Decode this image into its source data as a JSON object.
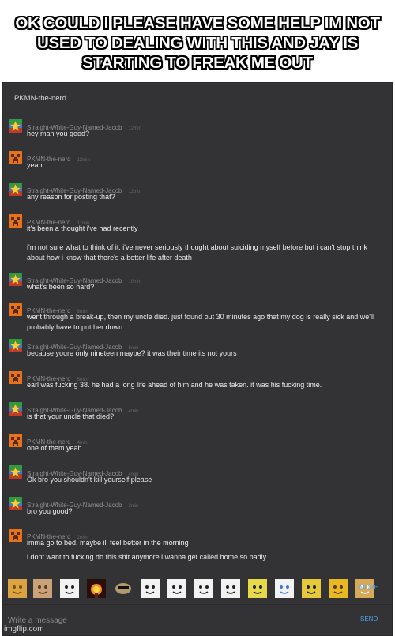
{
  "caption": "OK COULD I PLEASE HAVE SOME HELP IM NOT USED TO DEALING WITH THIS AND JAY IS STARTING TO FREAK ME OUT",
  "chat": {
    "header_title": "PKMN-the-nerd",
    "messages": [
      {
        "author": "Straight-White-Guy-Named-Jacob",
        "time": "12min",
        "avatar": "star-avatar-icon",
        "text": "hey man you good?"
      },
      {
        "author": "PKMN-the-nerd",
        "time": "12min",
        "avatar": "creeper-avatar-icon",
        "text": "yeah"
      },
      {
        "author": "Straight-White-Guy-Named-Jacob",
        "time": "12min",
        "avatar": "star-avatar-icon",
        "text": "any reason for posting that?"
      },
      {
        "author": "PKMN-the-nerd",
        "time": "11min",
        "avatar": "creeper-avatar-icon",
        "text": "it's been a thought i've had recently",
        "extra": "i'm not sure what to think of it. i've never seriously thought about suiciding myself before but i can't stop think about how i know that there's a better life after death"
      },
      {
        "author": "Straight-White-Guy-Named-Jacob",
        "time": "10min",
        "avatar": "star-avatar-icon",
        "text": "what's been so hard?"
      },
      {
        "author": "PKMN-the-nerd",
        "time": "8min",
        "avatar": "creeper-avatar-icon",
        "text": "went through a break-up, then my uncle died. just found out 30 minutes ago that my dog is really sick and we'll probably have to put her down"
      },
      {
        "author": "Straight-White-Guy-Named-Jacob",
        "time": "6min",
        "avatar": "star-avatar-icon",
        "text": "because youre only nineteen maybe? it was their time its not yours"
      },
      {
        "author": "PKMN-the-nerd",
        "time": "5min",
        "avatar": "creeper-avatar-icon",
        "text": "earl was fucking 38. he had a long life ahead of him and he was taken. it was his fucking time."
      },
      {
        "author": "Straight-White-Guy-Named-Jacob",
        "time": "4min",
        "avatar": "star-avatar-icon",
        "text": "is that your uncle that died?"
      },
      {
        "author": "PKMN-the-nerd",
        "time": "4min",
        "avatar": "creeper-avatar-icon",
        "text": "one of them yeah"
      },
      {
        "author": "Straight-White-Guy-Named-Jacob",
        "time": "4min",
        "avatar": "star-avatar-icon",
        "text": "Ok bro you shouldn't kill yourself please"
      },
      {
        "author": "Straight-White-Guy-Named-Jacob",
        "time": "3min",
        "avatar": "star-avatar-icon",
        "text": "bro you good?"
      },
      {
        "author": "PKMN-the-nerd",
        "time": "2min",
        "avatar": "creeper-avatar-icon",
        "text": "imma go to bed. maybe ill feel better in the morning",
        "extra": "i dont want to fucking do this shit anymore i wanna get called home so badly"
      }
    ],
    "emoji_icons": [
      "cat-face-icon",
      "jesus-face-icon",
      "rage-face-icon",
      "explosion-icon",
      "cool-face-icon",
      "ohgod-face-icon",
      "smiling-face-icon",
      "troll-face-icon",
      "yay-face-icon",
      "deal-with-it-face-icon",
      "happy-cry-face-icon",
      "girl-face-icon",
      "bearded-face-icon",
      "doge-face-icon"
    ],
    "more_label": "MORE",
    "input_placeholder": "Write a message",
    "send_label": "SEND"
  },
  "watermark": "imgflip.com",
  "colors": {
    "panel": "#333335",
    "link": "#4aa8e8",
    "creeper": "#e8721c",
    "star_bg": "#3a7bd5",
    "star": "#f4d03f"
  }
}
